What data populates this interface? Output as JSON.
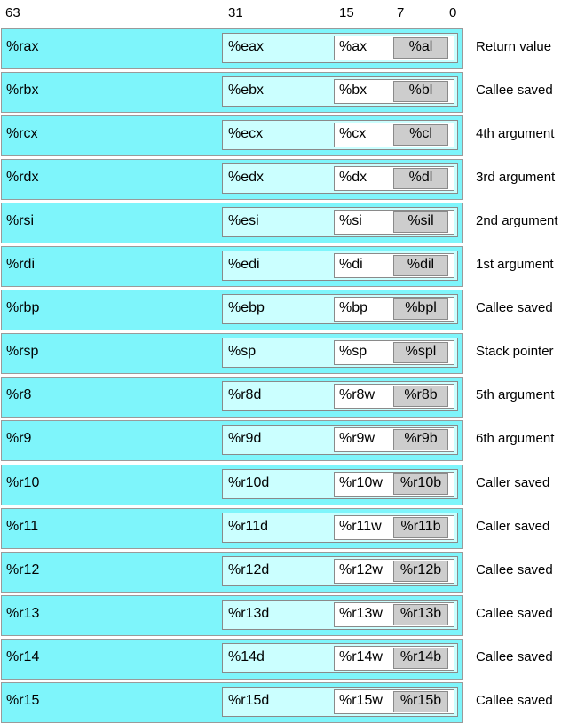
{
  "bit_positions": [
    "63",
    "31",
    "15",
    "7",
    "0"
  ],
  "registers": [
    {
      "r64": "%rax",
      "r32": "%eax",
      "r16": "%ax",
      "r8": "%al",
      "use": "Return value"
    },
    {
      "r64": "%rbx",
      "r32": "%ebx",
      "r16": "%bx",
      "r8": "%bl",
      "use": "Callee saved"
    },
    {
      "r64": "%rcx",
      "r32": "%ecx",
      "r16": "%cx",
      "r8": "%cl",
      "use": "4th argument"
    },
    {
      "r64": "%rdx",
      "r32": "%edx",
      "r16": "%dx",
      "r8": "%dl",
      "use": "3rd argument"
    },
    {
      "r64": "%rsi",
      "r32": "%esi",
      "r16": "%si",
      "r8": "%sil",
      "use": "2nd argument"
    },
    {
      "r64": "%rdi",
      "r32": "%edi",
      "r16": "%di",
      "r8": "%dil",
      "use": "1st argument"
    },
    {
      "r64": "%rbp",
      "r32": "%ebp",
      "r16": "%bp",
      "r8": "%bpl",
      "use": "Callee saved"
    },
    {
      "r64": "%rsp",
      "r32": "%sp",
      "r16": "%sp",
      "r8": "%spl",
      "use": "Stack pointer"
    },
    {
      "r64": "%r8",
      "r32": "%r8d",
      "r16": "%r8w",
      "r8": "%r8b",
      "use": "5th argument"
    },
    {
      "r64": "%r9",
      "r32": "%r9d",
      "r16": "%r9w",
      "r8": "%r9b",
      "use": "6th argument"
    },
    {
      "r64": "%r10",
      "r32": "%r10d",
      "r16": "%r10w",
      "r8": "%r10b",
      "use": "Caller saved"
    },
    {
      "r64": "%r11",
      "r32": "%r11d",
      "r16": "%r11w",
      "r8": "%r11b",
      "use": "Caller saved"
    },
    {
      "r64": "%r12",
      "r32": "%r12d",
      "r16": "%r12w",
      "r8": "%r12b",
      "use": "Callee saved"
    },
    {
      "r64": "%r13",
      "r32": "%r13d",
      "r16": "%r13w",
      "r8": "%r13b",
      "use": "Callee saved"
    },
    {
      "r64": "%r14",
      "r32": "%14d",
      "r16": "%r14w",
      "r8": "%r14b",
      "use": "Callee saved"
    },
    {
      "r64": "%r15",
      "r32": "%r15d",
      "r16": "%r15w",
      "r8": "%r15b",
      "use": "Callee saved"
    }
  ],
  "colors": {
    "r64_fill": "#7ef5fb",
    "r32_fill": "#cbffff",
    "r16_fill": "#ffffff",
    "r8_fill": "#cdcdcd"
  }
}
